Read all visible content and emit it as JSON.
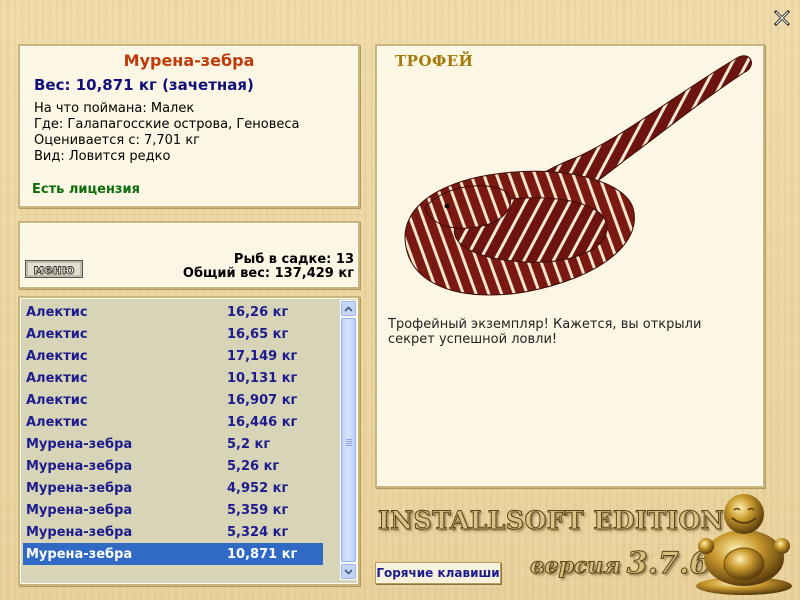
{
  "close_icon": "close-x-icon",
  "fish": {
    "name": "Мурена-зебра",
    "weight": "Вес: 10,871 кг (зачетная)",
    "bait": "На что поймана: Малек",
    "location": "Где: Галапагосские острова, Геновеса",
    "min_weight": "Оценивается с: 7,701 кг",
    "rarity": "Вид: Ловится редко",
    "license": "Есть лицензия"
  },
  "keepnet": {
    "menu_label": "меню",
    "count": "Рыб в садке: 13",
    "total_weight": "Общий вес: 137,429 кг"
  },
  "trophy": {
    "title": "ТРОФЕЙ",
    "text": "Трофейный экземпляр! Кажется, вы открыли секрет успешной ловли!",
    "image": "zebra-moray-eel"
  },
  "catches": [
    {
      "name": "Алектис",
      "weight": "16,26 кг"
    },
    {
      "name": "Алектис",
      "weight": "16,65 кг"
    },
    {
      "name": "Алектис",
      "weight": "17,149 кг"
    },
    {
      "name": "Алектис",
      "weight": "10,131 кг"
    },
    {
      "name": "Алектис",
      "weight": "16,907 кг"
    },
    {
      "name": "Алектис",
      "weight": "16,446 кг"
    },
    {
      "name": "Мурена-зебра",
      "weight": "5,2 кг"
    },
    {
      "name": "Мурена-зебра",
      "weight": "5,26 кг"
    },
    {
      "name": "Мурена-зебра",
      "weight": "4,952 кг"
    },
    {
      "name": "Мурена-зебра",
      "weight": "5,359 кг"
    },
    {
      "name": "Мурена-зебра",
      "weight": "5,324 кг"
    },
    {
      "name": "Мурена-зебра",
      "weight": "10,871 кг",
      "selected": true
    }
  ],
  "brand": {
    "edition": "INSTALLSOFT EDITION",
    "version_word": "версия",
    "version_number": "3.7.6"
  },
  "hotkeys_label": "Горячие клавиши",
  "colors": {
    "fish_name": "#c03a0a",
    "weight": "#10107a",
    "license": "#0c6e0c",
    "list_text": "#1c1c8e",
    "selection": "#316ac5",
    "trophy_title": "#a57a0b"
  }
}
